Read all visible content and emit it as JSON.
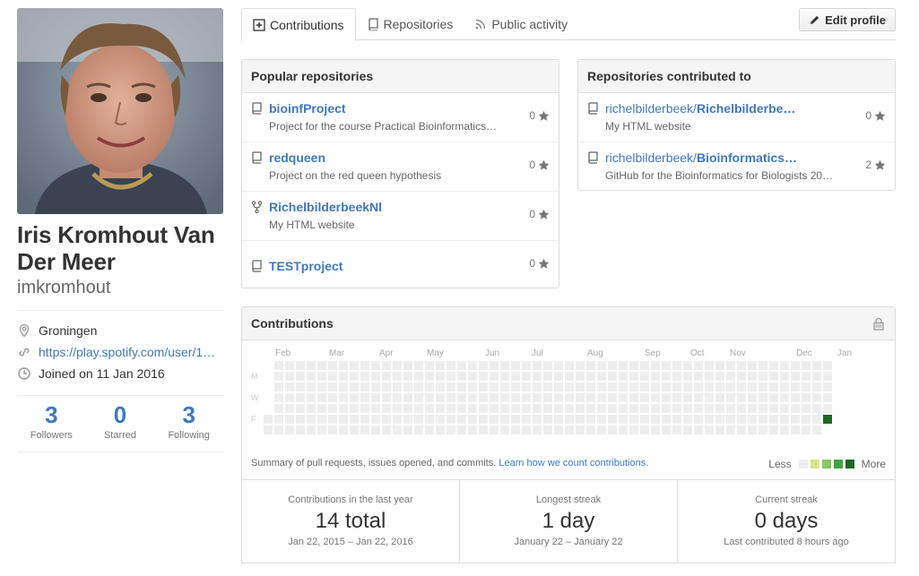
{
  "profile": {
    "fullname": "Iris Kromhout Van Der Meer",
    "username": "imkromhout",
    "location": "Groningen",
    "website": "https://play.spotify.com/user/1…",
    "joined": "Joined on 11 Jan 2016",
    "stats": [
      {
        "num": "3",
        "label": "Followers"
      },
      {
        "num": "0",
        "label": "Starred"
      },
      {
        "num": "3",
        "label": "Following"
      }
    ]
  },
  "tabs": [
    {
      "label": "Contributions",
      "icon": "diff-added-icon",
      "selected": true
    },
    {
      "label": "Repositories",
      "icon": "repo-icon",
      "selected": false
    },
    {
      "label": "Public activity",
      "icon": "rss-icon",
      "selected": false
    }
  ],
  "edit_profile": "Edit profile",
  "popular": {
    "title": "Popular repositories",
    "repos": [
      {
        "name": "bioinfProject",
        "desc": "Project for the course Practical Bioinformatics…",
        "stars": "0",
        "icon": "repo-icon"
      },
      {
        "name": "redqueen",
        "desc": "Project on the red queen hypothesis",
        "stars": "0",
        "icon": "repo-icon"
      },
      {
        "name": "RichelbilderbeekNl",
        "desc": "My HTML website",
        "stars": "0",
        "icon": "fork-icon"
      },
      {
        "name": "TESTproject",
        "desc": "",
        "stars": "0",
        "icon": "repo-icon"
      }
    ]
  },
  "contributed": {
    "title": "Repositories contributed to",
    "repos": [
      {
        "owner": "richelbilderbeek/",
        "name": "Richelbilderbe…",
        "desc": "My HTML website",
        "stars": "0"
      },
      {
        "owner": "richelbilderbeek/",
        "name": "Bioinformatics…",
        "desc": "GitHub for the Bioinformatics for Biologists 20…",
        "stars": "2"
      }
    ]
  },
  "contributions": {
    "title": "Contributions",
    "months": [
      "Feb",
      "Mar",
      "Apr",
      "May",
      "Jun",
      "Jul",
      "Aug",
      "Sep",
      "Oct",
      "Nov",
      "Dec",
      "Jan"
    ],
    "day_labels": [
      "M",
      "W",
      "F"
    ],
    "summary": "Summary of pull requests, issues opened, and commits.",
    "learn_link": "Learn how we count contributions.",
    "legend_less": "Less",
    "legend_more": "More",
    "colors": [
      "#eeeeee",
      "#d6e685",
      "#8cc665",
      "#44a340",
      "#1e6823"
    ],
    "active_cell": {
      "week_index": 52,
      "day_index": 5,
      "level": 4
    }
  },
  "streaks": [
    {
      "label": "Contributions in the last year",
      "value": "14 total",
      "dates": "Jan 22, 2015 – Jan 22, 2016"
    },
    {
      "label": "Longest streak",
      "value": "1 day",
      "dates": "January 22 – January 22"
    },
    {
      "label": "Current streak",
      "value": "0 days",
      "dates": "Last contributed 8 hours ago"
    }
  ]
}
